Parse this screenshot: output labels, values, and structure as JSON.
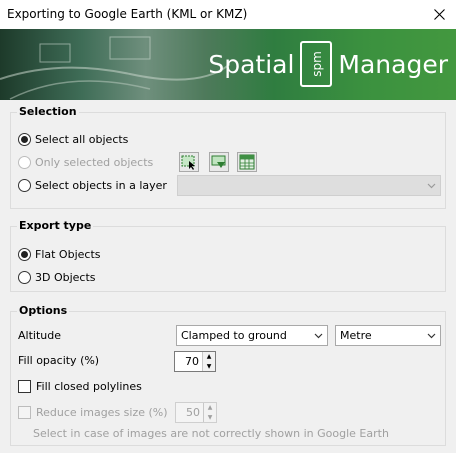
{
  "window": {
    "title": "Exporting to Google Earth (KML or KMZ)"
  },
  "banner": {
    "word1": "Spatial",
    "logo_text": "spm",
    "word2": "Manager"
  },
  "selection": {
    "title": "Selection",
    "select_all": "Select all objects",
    "only_selected": "Only selected objects",
    "in_layer": "Select objects in a layer",
    "layer_value": ""
  },
  "export_type": {
    "title": "Export type",
    "flat": "Flat Objects",
    "objects3d": "3D Objects"
  },
  "options": {
    "title": "Options",
    "altitude_label": "Altitude",
    "altitude_value": "Clamped to ground",
    "unit_value": "Metre",
    "fill_opacity_label": "Fill opacity (%)",
    "fill_opacity_value": "70",
    "fill_closed_label": "Fill closed polylines",
    "reduce_label": "Reduce images size (%)",
    "reduce_value": "50",
    "hint": "Select in case of images are not correctly shown in Google Earth"
  },
  "colors": {
    "banner_green": "#3b913f",
    "group_border": "#dcdcdc"
  },
  "icons": {
    "close": "close-icon",
    "select_window": "select-window-icon",
    "select_pick": "select-pick-icon",
    "select_table": "select-table-icon"
  }
}
